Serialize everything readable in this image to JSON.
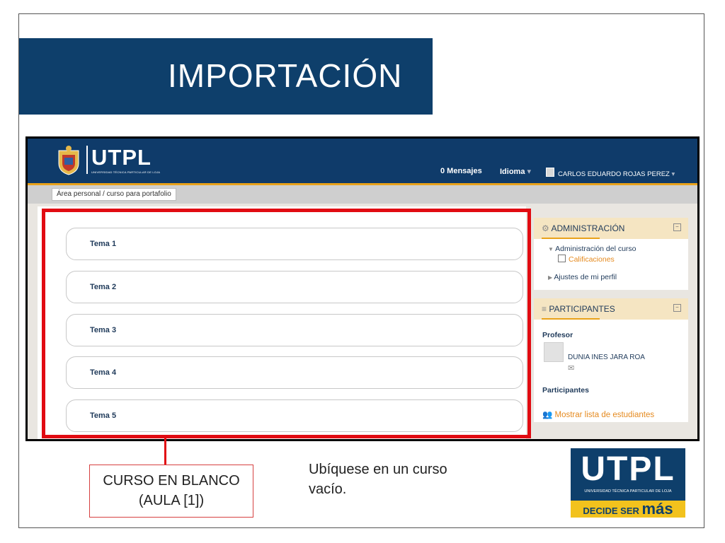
{
  "slide": {
    "title": "IMPORTACIÓN",
    "callout_line1": "CURSO EN BLANCO",
    "callout_line2": "(AULA [1])",
    "caption_line1": "Ubíquese en un curso",
    "caption_line2": "vacío."
  },
  "header": {
    "logo_text": "UTPL",
    "logo_sub": "UNIVERSIDAD TÉCNICA PARTICULAR DE LOJA",
    "messages": "0 Mensajes",
    "language": "Idioma",
    "user": "CARLOS EDUARDO ROJAS PEREZ"
  },
  "breadcrumb": {
    "home": "Área personal",
    "separator": "/",
    "course": "curso para portafolio"
  },
  "topics": [
    "Tema 1",
    "Tema 2",
    "Tema 3",
    "Tema 4",
    "Tema 5"
  ],
  "admin_block": {
    "title": "ADMINISTRACIÓN",
    "item1": "Administración del curso",
    "item1_sub": "Calificaciones",
    "item2": "Ajustes de mi perfil"
  },
  "participants_block": {
    "title": "PARTICIPANTES",
    "teacher_label": "Profesor",
    "teacher_name": "DUNIA INES JARA ROA",
    "participants_label": "Participantes",
    "show_list": "Mostrar lista de estudiantes"
  },
  "brand": {
    "name": "UTPL",
    "subtitle": "UNIVERSIDAD TÉCNICA PARTICULAR DE LOJA",
    "slogan_prefix": "DECIDE SER",
    "slogan_mas": "más"
  },
  "colors": {
    "navy": "#0e3f6b",
    "accent_orange": "#e9a21a",
    "highlight_red": "#e10b12",
    "brand_yellow": "#f2c21d"
  },
  "icons": {
    "admin": "gear-icon",
    "participants": "menu-lines-icon",
    "user": "user-icon",
    "mail": "envelope-icon",
    "students": "group-icon"
  }
}
